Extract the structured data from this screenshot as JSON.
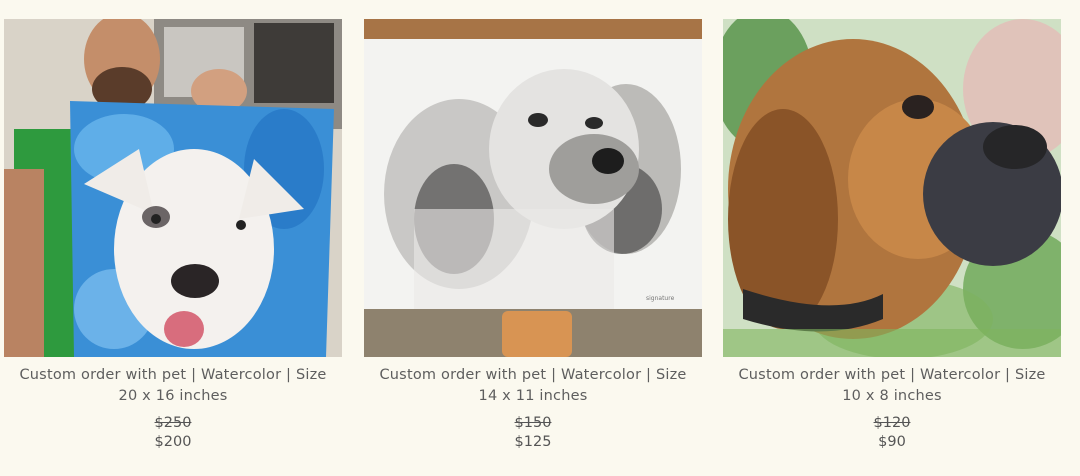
{
  "products": [
    {
      "title_line1": "Custom order with pet | Watercolor | Size",
      "title_line2": "20 x 16 inches",
      "old_price": "$250",
      "price": "$200",
      "image": "white-pitbull-watercolor-portrait"
    },
    {
      "title_line1": "Custom order with pet | Watercolor | Size",
      "title_line2": "14 x 11 inches",
      "old_price": "$150",
      "price": "$125",
      "image": "cocker-spaniel-ink-portrait"
    },
    {
      "title_line1": "Custom order with pet | Watercolor | Size",
      "title_line2": "10 x 8 inches",
      "old_price": "$120",
      "price": "$90",
      "image": "boxer-watercolor-portrait"
    }
  ]
}
